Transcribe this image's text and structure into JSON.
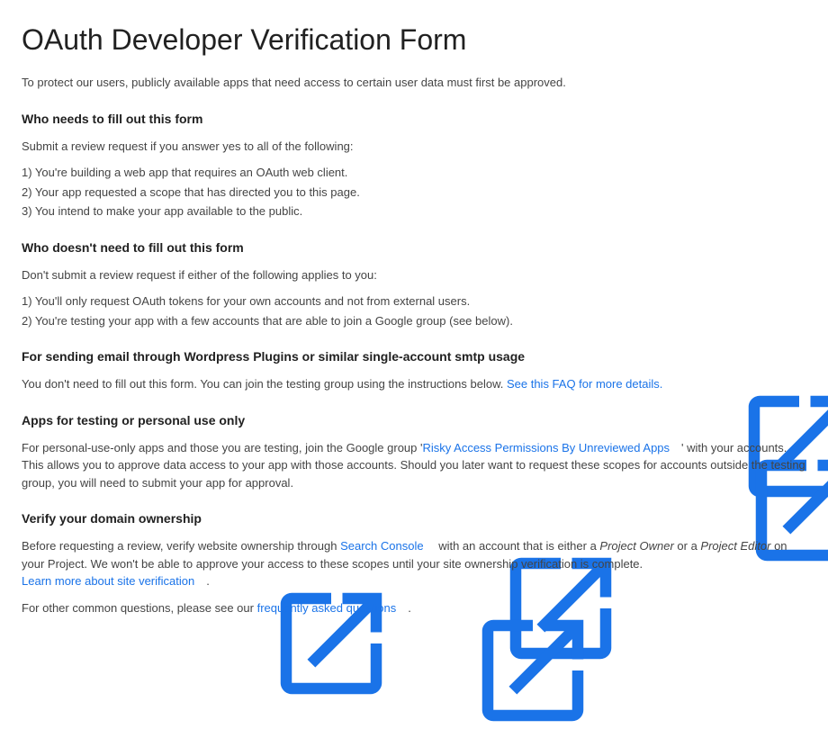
{
  "title": "OAuth Developer Verification Form",
  "intro": "To protect our users, publicly available apps that need access to certain user data must first be approved.",
  "sec1": {
    "heading": "Who needs to fill out this form",
    "lead": "Submit a review request if you answer yes to all of the following:",
    "items": {
      "i0": "1) You're building a web app that requires an OAuth web client.",
      "i1": "2) Your app requested a scope that has directed you to this page.",
      "i2": "3) You intend to make your app available to the public."
    }
  },
  "sec2": {
    "heading": "Who doesn't need to fill out this form",
    "lead": "Don't submit a review request if either of the following applies to you:",
    "items": {
      "i0": "1) You'll only request OAuth tokens for your own accounts and not from external users.",
      "i1": "2) You're testing your app with a few accounts that are able to join a Google group (see below)."
    }
  },
  "sec3": {
    "heading": "For sending email through Wordpress Plugins or similar single-account smtp usage",
    "text": "You don't need to fill out this form. You can join the testing group using the instructions below. ",
    "link": "See this FAQ for more details."
  },
  "sec4": {
    "heading": "Apps for testing or personal use only",
    "pre": "For personal-use-only apps and those you are testing, join the Google group '",
    "link": "Risky Access Permissions By Unreviewed Apps",
    "post": "' with your accounts. This allows you to approve data access to your app with those accounts. Should you later want to request these scopes for accounts outside the testing group, you will need to submit your app for approval."
  },
  "sec5": {
    "heading": "Verify your domain ownership",
    "p1_pre": "Before requesting a review, verify website ownership through ",
    "p1_link1": "Search Console",
    "p1_mid1": " with an account that is either a ",
    "p1_em1": "Project Owner",
    "p1_mid2": " or a ",
    "p1_em2": "Project Editor",
    "p1_mid3": " on your Project. We won't be able to approve your access to these scopes until your site ownership verification is complete. ",
    "p1_link2": "Learn more about site verification",
    "p1_end": ".",
    "p2_pre": "For other common questions, please see our ",
    "p2_link": "frequently asked questions",
    "p2_end": "."
  }
}
